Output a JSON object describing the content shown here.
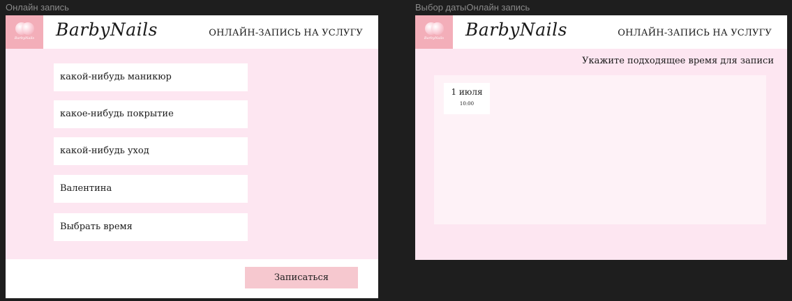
{
  "frames": [
    {
      "label": "Онлайн запись"
    },
    {
      "label": "Выбор датыОнлайн запись"
    }
  ],
  "header": {
    "brand": "BarbyNails",
    "logo_text": "BarbyNails",
    "title": "ОНЛАЙН-ЗАПИСЬ НА УСЛУГУ"
  },
  "booking_form": {
    "fields": [
      {
        "value": "какой-нибудь маникюр"
      },
      {
        "value": "какое-нибудь покрытие"
      },
      {
        "value": "какой-нибудь уход"
      },
      {
        "value": "Валентина"
      },
      {
        "value": "Выбрать время"
      }
    ],
    "submit_label": "Записаться"
  },
  "date_picker": {
    "hint": "Укажите подходящее время для записи",
    "slots": [
      {
        "date": "1 июля",
        "time": "10:00"
      }
    ]
  },
  "colors": {
    "canvas": "#1e1e1e",
    "pink_background": "#fde6f1",
    "button": "#f6c8cf",
    "logo_pink": "#f3aeb9"
  }
}
